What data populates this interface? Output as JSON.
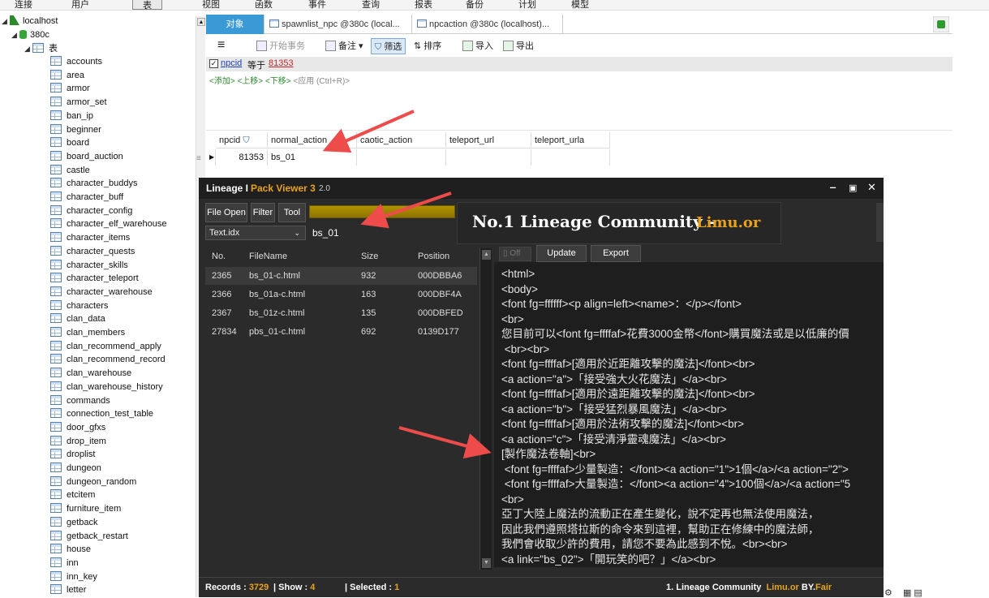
{
  "menu": {
    "items": [
      {
        "label": "连接"
      },
      {
        "label": "用户"
      },
      {
        "label": "表"
      },
      {
        "label": "视图"
      },
      {
        "label": "函数"
      },
      {
        "label": "事件"
      },
      {
        "label": "查询"
      },
      {
        "label": "报表"
      },
      {
        "label": "备份"
      },
      {
        "label": "计划"
      },
      {
        "label": "模型"
      }
    ]
  },
  "tree": {
    "connection": "localhost",
    "database": "380c",
    "tables_node": "表",
    "tables": [
      "accounts",
      "area",
      "armor",
      "armor_set",
      "ban_ip",
      "beginner",
      "board",
      "board_auction",
      "castle",
      "character_buddys",
      "character_buff",
      "character_config",
      "character_elf_warehouse",
      "character_items",
      "character_quests",
      "character_skills",
      "character_teleport",
      "character_warehouse",
      "characters",
      "clan_data",
      "clan_members",
      "clan_recommend_apply",
      "clan_recommend_record",
      "clan_warehouse",
      "clan_warehouse_history",
      "commands",
      "connection_test_table",
      "door_gfxs",
      "drop_item",
      "droplist",
      "dungeon",
      "dungeon_random",
      "etcitem",
      "furniture_item",
      "getback",
      "getback_restart",
      "house",
      "inn",
      "inn_key",
      "letter"
    ]
  },
  "tabs": [
    {
      "label": "对象"
    },
    {
      "label": "spawnlist_npc @380c (local..."
    },
    {
      "label": "npcaction @380c (localhost)..."
    }
  ],
  "toolbar": {
    "menu_icon": "≡",
    "begin_tx": "开始事务",
    "memo": "备注",
    "filter": "筛选",
    "sort": "排序",
    "import": "导入",
    "export": "导出"
  },
  "filter": {
    "field": "npcid",
    "op": "等于",
    "value": "81353",
    "hint_add": "<添加>",
    "hint_up": "<上移>",
    "hint_down": "<下移>",
    "hint_apply": "<应用 (Ctrl+R)>"
  },
  "grid": {
    "columns": [
      "npcid",
      "normal_action",
      "caotic_action",
      "teleport_url",
      "teleport_urla"
    ],
    "row": {
      "npcid": "81353",
      "normal_action": "bs_01"
    }
  },
  "viewer": {
    "title_a": "Lineage I",
    "title_b": "Pack Viewer 3",
    "title_c": "2.0",
    "btn_file_open": "File Open",
    "btn_filter": "Filter",
    "btn_tool": "Tool",
    "idx_select": "Text.idx",
    "search_value": "bs_01",
    "banner_title": "No.1 Lineage Community",
    "banner_dash": "-",
    "banner_site": "Limu.or",
    "toggle_off": "Off",
    "btn_update": "Update",
    "btn_export": "Export",
    "file_headers": {
      "no": "No.",
      "name": "FileName",
      "size": "Size",
      "pos": "Position"
    },
    "files": [
      {
        "no": "2365",
        "name": "bs_01-c.html",
        "size": "932",
        "pos": "000DBBA6"
      },
      {
        "no": "2366",
        "name": "bs_01a-c.html",
        "size": "163",
        "pos": "000DBF4A"
      },
      {
        "no": "2367",
        "name": "bs_01z-c.html",
        "size": "135",
        "pos": "000DBFED"
      },
      {
        "no": "27834",
        "name": "pbs_01-c.html",
        "size": "692",
        "pos": "0139D177"
      }
    ],
    "content_lines": [
      "<html>",
      "<body>",
      "<font fg=ffffff><p align=left><name>：</p></font>",
      "<br>",
      "您目前可以<font fg=ffffaf>花費3000金幣</font>購買魔法或是以低廉的價",
      " <br><br>",
      "<font fg=ffffaf>[適用於近距離攻擊的魔法]</font><br>",
      "<a action=\"a\">「接受強大火花魔法」</a><br>",
      "<font fg=ffffaf>[適用於遠距離攻擊的魔法]</font><br>",
      "<a action=\"b\">「接受猛烈暴風魔法」</a><br>",
      "<font fg=ffffaf>[適用於法術攻擊的魔法]</font><br>",
      "<a action=\"c\">「接受清淨靈魂魔法」</a><br>",
      "[製作魔法卷軸]<br>",
      " <font fg=ffffaf>少量製造：</font><a action=\"1\">1個</a>/<a action=\"2\">",
      " <font fg=ffffaf>大量製造：</font><a action=\"4\">100個</a>/<a action=\"5",
      "<br>",
      "亞丁大陸上魔法的流動正在產生變化，說不定再也無法使用魔法，",
      "因此我們遵照塔拉斯的命令來到這裡，幫助正在修練中的魔法師，",
      "我們會收取少許的費用，請您不要為此感到不悅。<br><br>",
      "<a link=\"bs_02\">「開玩笑的吧？」</a><br>"
    ],
    "status": {
      "records_label": "Records :",
      "records_value": "3729",
      "show_label": "| Show :",
      "show_value": "4",
      "selected_label": "| Selected :",
      "selected_value": "1",
      "footer_a": "1. Lineage Community",
      "footer_b": "Limu.or",
      "footer_c": "BY.",
      "footer_d": "Fair"
    }
  },
  "colors": {
    "accent": "#3b9ad6",
    "highlight": "#e8a21a",
    "arrow": "#ee4b4b"
  }
}
